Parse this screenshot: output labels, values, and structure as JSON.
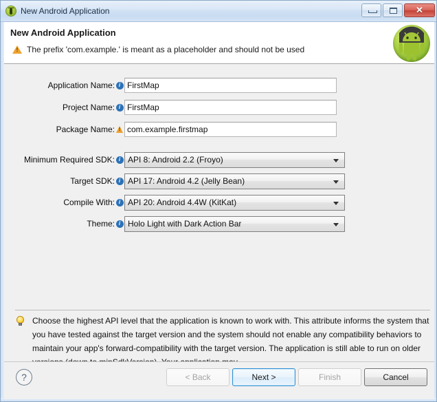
{
  "window": {
    "title": "New Android Application",
    "title_icon": "android-circle-icon",
    "controls": {
      "minimize": "minimize-icon",
      "maximize": "maximize-icon",
      "close": "✕"
    }
  },
  "header": {
    "title": "New Android Application",
    "message": "The prefix 'com.example.' is meant as a placeholder and should not be used",
    "message_icon": "warning-icon",
    "logo": "android-robot-logo"
  },
  "form": {
    "text_fields": [
      {
        "label": "Application Name:",
        "icon": "info-icon",
        "value": "FirstMap"
      },
      {
        "label": "Project Name:",
        "icon": "info-icon",
        "value": "FirstMap"
      },
      {
        "label": "Package Name:",
        "icon": "warning-icon",
        "value": "com.example.firstmap"
      }
    ],
    "dropdowns": [
      {
        "label": "Minimum Required SDK:",
        "icon": "info-icon",
        "value": "API 8: Android 2.2 (Froyo)"
      },
      {
        "label": "Target SDK:",
        "icon": "info-icon",
        "value": "API 17: Android 4.2 (Jelly Bean)"
      },
      {
        "label": "Compile With:",
        "icon": "info-icon",
        "value": "API 20: Android 4.4W (KitKat)"
      },
      {
        "label": "Theme:",
        "icon": "info-icon",
        "value": "Holo Light with Dark Action Bar"
      }
    ]
  },
  "help": {
    "icon": "lightbulb-icon",
    "text": "Choose the highest API level that the application is known to work with. This attribute informs the system that you have tested against the target version and the system should not enable any compatibility behaviors to maintain your app's forward-compatibility with the target version. The application is still able to run on older versions (down to minSdkVersion). Your application may"
  },
  "footer": {
    "help_icon": "?",
    "buttons": [
      {
        "label": "< Back",
        "state": "disabled"
      },
      {
        "label": "Next >",
        "state": "default"
      },
      {
        "label": "Finish",
        "state": "disabled"
      },
      {
        "label": "Cancel",
        "state": "focus"
      }
    ]
  },
  "colors": {
    "accent": "#2c8fd4",
    "android_green": "#a4c639",
    "warning": "#f0a22e",
    "titlebar": "#cfe0f3",
    "body": "#f0f0f0"
  }
}
